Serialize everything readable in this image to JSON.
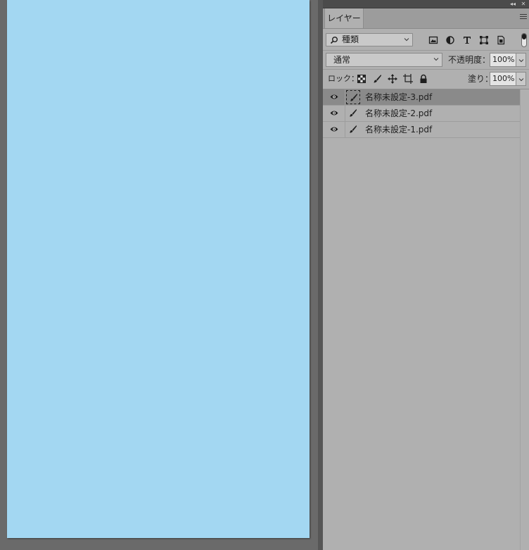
{
  "panel": {
    "tab_label": "レイヤー",
    "topbar": {
      "collapse_glyph": "◂◂",
      "close_glyph": "✕"
    }
  },
  "filter": {
    "kind_label": "種類",
    "icons": [
      "image-filter-icon",
      "adjustment-filter-icon",
      "type-filter-icon",
      "shape-filter-icon",
      "smart-object-filter-icon"
    ]
  },
  "blend": {
    "mode": "通常",
    "opacity_label": "不透明度：",
    "opacity_value": "100%"
  },
  "lock": {
    "label": "ロック：",
    "fill_label": "塗り：",
    "fill_value": "100%"
  },
  "layers": [
    {
      "name": "名称未設定-3.pdf",
      "selected": true
    },
    {
      "name": "名称未設定-2.pdf",
      "selected": false
    },
    {
      "name": "名称未設定-1.pdf",
      "selected": false
    }
  ],
  "colors": {
    "document_fill": "#a3d7f2",
    "panel_bg": "#b0b0b0",
    "workspace_bg": "#6a6a6a",
    "selected_row": "#8a8a8a"
  }
}
